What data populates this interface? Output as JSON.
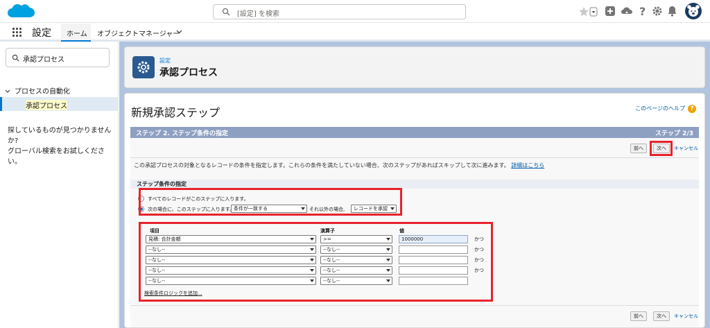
{
  "header": {
    "search_placeholder": "[設定] を検索"
  },
  "nav": {
    "app_name": "設定",
    "tab_home": "ホーム",
    "tab_object_manager": "オブジェクトマネージャー"
  },
  "sidebar": {
    "quick_find_value": "承認プロセス",
    "tree_parent": "プロセスの自動化",
    "tree_child": "承認プロセス",
    "not_found_line1": "探しているものが見つかりませんか?",
    "not_found_line2": "グローバル検索をお試しください。"
  },
  "page_header": {
    "subtitle": "設定",
    "title": "承認プロセス"
  },
  "content": {
    "page_title": "新規承認ステップ",
    "help_link": "このページのヘルプ",
    "step_bar_left": "ステップ 2. ステップ条件の指定",
    "step_bar_right": "ステップ 2/3",
    "prev_button": "前へ",
    "next_button": "次へ",
    "cancel_link": "キャンセル",
    "description": "この承認プロセスの対象となるレコードの条件を指定します。これらの条件を満たしていない場合、次のステップがあればスキップして次に進みます。",
    "details_link": "詳細はこちら",
    "section_title": "ステップ条件の指定",
    "radio_all": "すべてのレコードがこのステップに入ります。",
    "radio_if": "次の場合に、このステップに入ります。",
    "criteria_select": "条件が一致する",
    "else_label": "それ以外の場合,",
    "else_select": "レコードを承認",
    "col_field": "項目",
    "col_operator": "演算子",
    "col_value": "値",
    "rows": [
      {
        "field": "見積: 合計金額",
        "operator": ">=",
        "value": "1000000",
        "and": "かつ"
      },
      {
        "field": "--なし--",
        "operator": "--なし--",
        "value": "",
        "and": "かつ"
      },
      {
        "field": "--なし--",
        "operator": "--なし--",
        "value": "",
        "and": "かつ"
      },
      {
        "field": "--なし--",
        "operator": "--なし--",
        "value": "",
        "and": "かつ"
      },
      {
        "field": "--なし--",
        "operator": "--なし--",
        "value": "",
        "and": ""
      }
    ],
    "add_logic_link": "検索条件ロジックを追加..."
  },
  "colors": {
    "brand_blue": "#0176d3",
    "highlight_red": "#e8222b",
    "step_bar": "#8ea0c2"
  }
}
